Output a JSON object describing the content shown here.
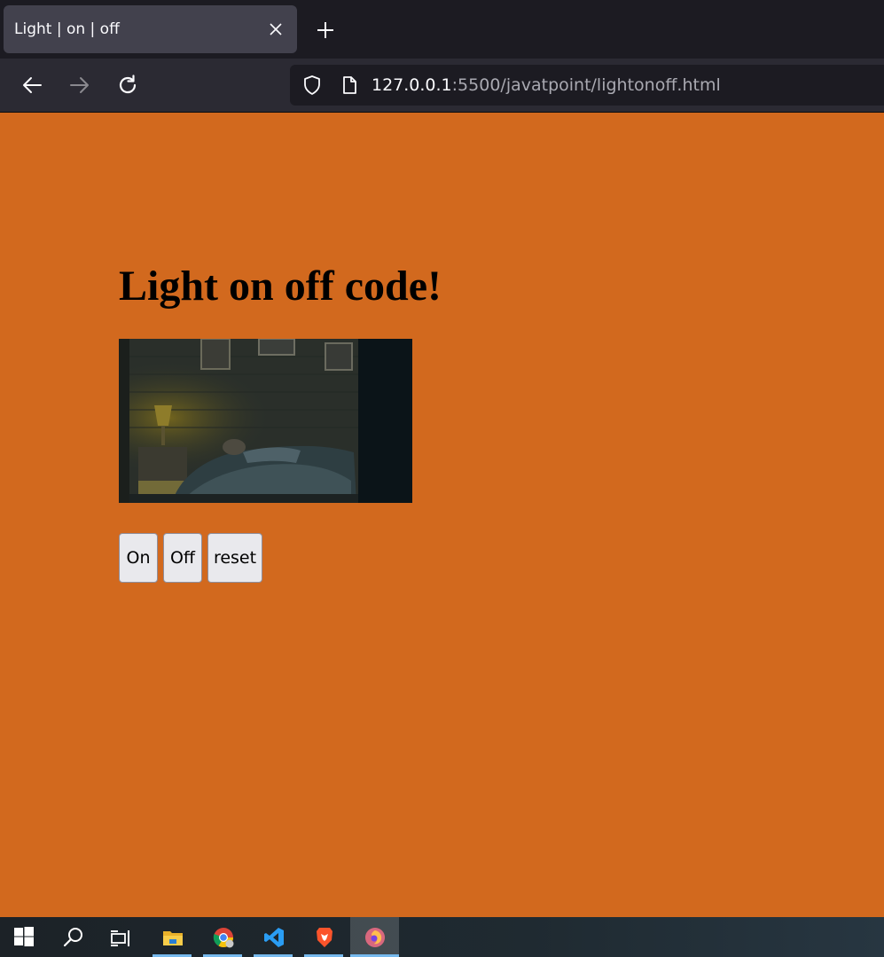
{
  "browser": {
    "tab": {
      "title": "Light | on | off",
      "close_icon": "close-icon"
    },
    "new_tab_icon": "plus-icon",
    "nav": {
      "back_icon": "arrow-left-icon",
      "forward_icon": "arrow-right-icon",
      "reload_icon": "reload-icon"
    },
    "url": {
      "host": "127.0.0.1",
      "rest": ":5500/javatpoint/lightonoff.html",
      "shield_icon": "shield-icon",
      "page_icon": "page-icon"
    }
  },
  "page": {
    "heading": "Light on off code!",
    "background_color": "#d2691e",
    "image": {
      "description_icon": "bedroom-photo"
    },
    "buttons": {
      "on": "On",
      "off": "Off",
      "reset": "reset"
    }
  },
  "taskbar": {
    "items": [
      {
        "name": "windows-start-icon"
      },
      {
        "name": "search-icon"
      },
      {
        "name": "task-view-icon"
      },
      {
        "name": "file-explorer-icon"
      },
      {
        "name": "chrome-icon"
      },
      {
        "name": "vscode-icon"
      },
      {
        "name": "brave-icon"
      },
      {
        "name": "firefox-icon"
      }
    ]
  }
}
